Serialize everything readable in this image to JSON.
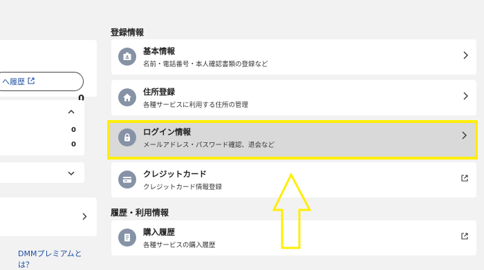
{
  "left": {
    "points_value": "0",
    "history_button_label": "へ履歴",
    "accordion1_values": [
      "0",
      "0"
    ],
    "premium_link": "DMMプレミアムとは？"
  },
  "registration": {
    "section_title": "登録情報",
    "items": [
      {
        "title": "基本情報",
        "subtitle": "名前・電話番号・本人確認書類の登録など",
        "icon": "id-card-icon",
        "action": "chevron"
      },
      {
        "title": "住所登録",
        "subtitle": "各種サービスに利用する住所の管理",
        "icon": "home-icon",
        "action": "chevron"
      },
      {
        "title": "ログイン情報",
        "subtitle": "メールアドレス・パスワード確認、退会など",
        "icon": "lock-icon",
        "action": "chevron"
      },
      {
        "title": "クレジットカード",
        "subtitle": "クレジットカード情報登録",
        "icon": "credit-card-icon",
        "action": "external"
      }
    ]
  },
  "history": {
    "section_title": "履歴・利用情報",
    "items": [
      {
        "title": "購入履歴",
        "subtitle": "各種サービスの購入履歴",
        "icon": "receipt-icon",
        "action": "external"
      }
    ]
  },
  "colors": {
    "highlight_border": "#ffee00",
    "arrow_stroke": "#ffee00",
    "icon_bg": "#8692a6",
    "link": "#1c4fa3"
  }
}
